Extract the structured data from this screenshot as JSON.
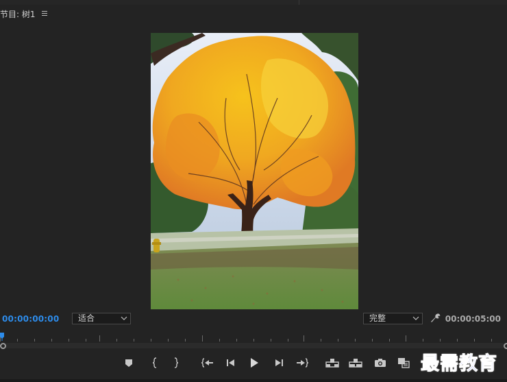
{
  "panel": {
    "title": "节目: 树1"
  },
  "viewer": {
    "content": "autumn maple tree photo"
  },
  "timecode": {
    "current": "00:00:00:00",
    "duration": "00:00:05:00"
  },
  "zoom_select": {
    "value": "适合"
  },
  "resolution_select": {
    "value": "完整"
  },
  "transport": {
    "icons": [
      "add-marker-icon",
      "mark-in-icon",
      "mark-out-icon",
      "go-to-in-icon",
      "step-back-icon",
      "play-icon",
      "step-forward-icon",
      "go-to-out-icon",
      "lift-icon",
      "extract-icon",
      "export-frame-icon",
      "comparison-view-icon"
    ]
  },
  "watermark": {
    "text": "最需教育"
  },
  "colors": {
    "accent": "#2d8ceb",
    "panel_bg": "#232323",
    "watermark": "#1b2fe0"
  }
}
